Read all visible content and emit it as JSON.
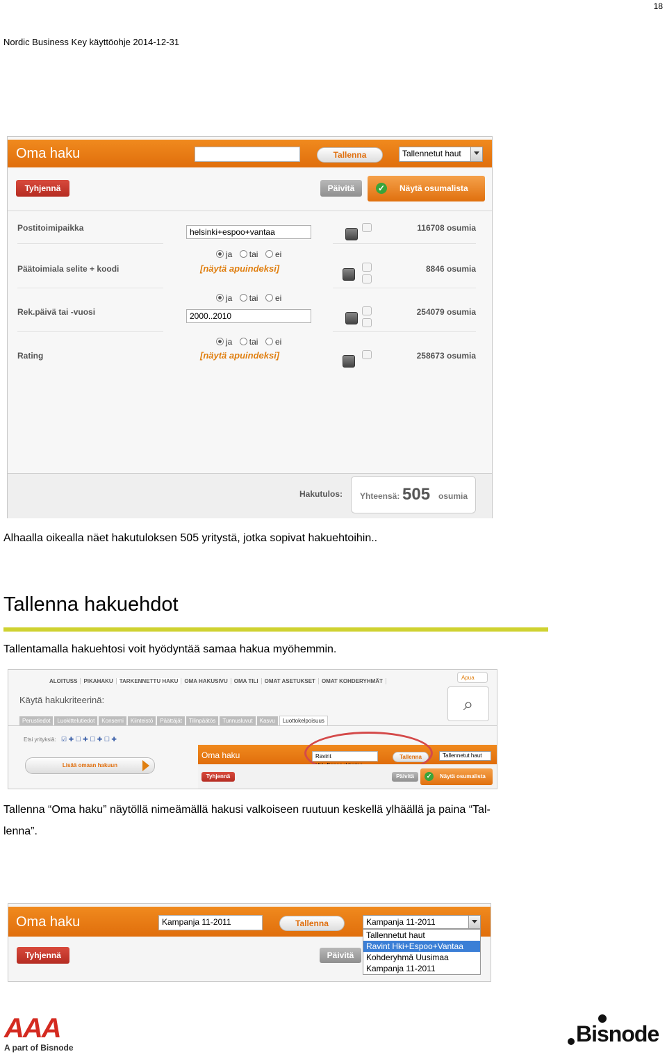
{
  "page": {
    "number": "18",
    "header": "Nordic Business Key käyttöohje 2014-12-31",
    "caption1": "Alhaalla oikealla näet hakutuloksen 505 yritystä, jotka sopivat hakuehtoihin..",
    "heading": "Tallenna hakuehdot",
    "paragraph": "Tallentamalla hakuehtosi voit hyödyntää samaa hakua myöhemmin.",
    "caption2_line1": "Tallenna “Oma haku” näytöllä nimeämällä hakusi valkoiseen ruutuun keskellä ylhäällä ja paina “Tal-",
    "caption2_line2": "lenna”."
  },
  "shot1": {
    "title": "Oma haku",
    "name_value": "",
    "save_btn": "Tallenna",
    "saved_dropdown": "Tallennetut haut",
    "clear_btn": "Tyhjennä",
    "update_btn": "Päivitä",
    "show_btn": "Näytä osumalista",
    "criteria": [
      {
        "label": "Postitoimipaikka",
        "value": "helsinki+espoo+vantaa",
        "count": "116708 osumia"
      },
      {
        "label": "Päätoimiala selite + koodi",
        "link": "[näytä apuindeksi]",
        "count": "8846 osumia"
      },
      {
        "label": "Rek.päivä tai -vuosi",
        "value": "2000..2010",
        "count": "254079 osumia"
      },
      {
        "label": "Rating",
        "link": "[näytä apuindeksi]",
        "count": "258673 osumia"
      }
    ],
    "radio": {
      "and": "ja",
      "or": "tai",
      "not": "ei"
    },
    "result_label": "Hakutulos:",
    "total_label": "Yhteensä:",
    "total_value": "505",
    "total_unit": "osumia"
  },
  "shot2": {
    "tabs": [
      "ALOITUSS",
      "PIKAHAKU",
      "TARKENNETTU HAKU",
      "OMA HAKUSIVU",
      "OMA TILI",
      "OMAT ASETUKSET",
      "OMAT KOHDERYHMÄT"
    ],
    "help": "Apua",
    "criteria_title": "Käytä hakukriteerinä:",
    "subtabs": [
      "Perustiedot",
      "Luokittelutiedot",
      "Konserni",
      "Kiinteistö",
      "Päättäjät",
      "Tilinpäätös",
      "Tunnusluvut",
      "Kasvu",
      "Luottokelpoisuus"
    ],
    "search_label": "Etsi yrityksiä:",
    "add_btn": "Lisää omaan hakuun",
    "title": "Oma haku",
    "name_value": "Ravint Hki+Espoo+Vantaa",
    "save_btn": "Tallenna",
    "saved_dropdown": "Tallennetut haut",
    "clear_btn": "Tyhjennä",
    "update_btn": "Päivitä",
    "show_btn": "Näytä osumalista"
  },
  "shot3": {
    "title": "Oma haku",
    "name_value": "Kampanja 11-2011",
    "save_btn": "Tallenna",
    "dropdown_value": "Kampanja 11-2011",
    "menu": [
      "Tallennetut haut",
      "Ravint Hki+Espoo+Vantaa",
      "Kohderyhmä Uusimaa",
      "Kampanja 11-2011"
    ],
    "clear_btn": "Tyhjennä",
    "update_btn": "Päivitä"
  },
  "footer": {
    "aaa_letters": "AAA",
    "aaa_tagline": "A part of Bisnode",
    "bisnode": "Bisnode"
  },
  "colors": {
    "orange": "#e8780f",
    "rule": "#cfd230",
    "red": "#c4372b",
    "link": "#e07f10"
  }
}
